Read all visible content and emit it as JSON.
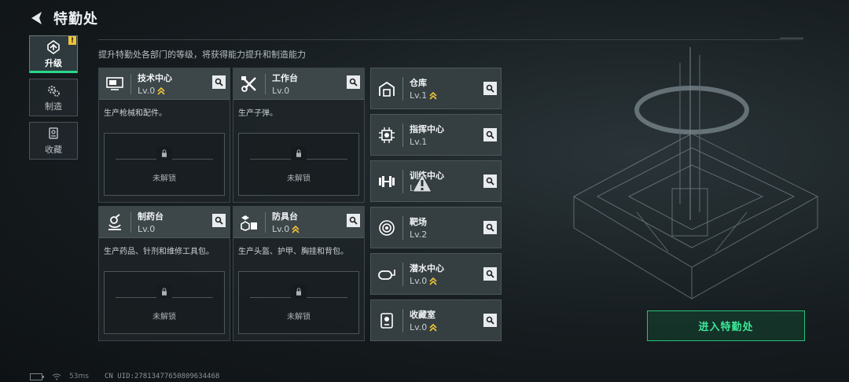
{
  "header": {
    "title": "特勤处",
    "description": "提升特勤处各部门的等级，将获得能力提升和制造能力"
  },
  "nav": {
    "items": [
      {
        "label": "升级",
        "icon": "upgrade-icon",
        "badge": "!"
      },
      {
        "label": "制造",
        "icon": "gear-icon"
      },
      {
        "label": "收藏",
        "icon": "collection-icon"
      }
    ]
  },
  "departments": [
    {
      "name": "技术中心",
      "level": "Lv.0",
      "icon": "computer-icon",
      "upgradeable": true,
      "desc": "生产枪械和配件。",
      "locked": "未解锁"
    },
    {
      "name": "工作台",
      "level": "Lv.0",
      "icon": "tools-icon",
      "upgradeable": false,
      "desc": "生产子弹。",
      "locked": "未解锁"
    },
    {
      "name": "制药台",
      "level": "Lv.0",
      "icon": "microscope-icon",
      "upgradeable": false,
      "desc": "生产药品、针剂和维修工具包。",
      "locked": "未解锁"
    },
    {
      "name": "防具台",
      "level": "Lv.0",
      "icon": "armor-icon",
      "upgradeable": true,
      "desc": "生产头盔、护甲、胸挂和背包。",
      "locked": "未解锁"
    }
  ],
  "facilities": [
    {
      "name": "仓库",
      "level": "Lv.1",
      "icon": "warehouse-icon",
      "upgradeable": true
    },
    {
      "name": "指挥中心",
      "level": "Lv.1",
      "icon": "chip-icon",
      "upgradeable": false
    },
    {
      "name": "训练中心",
      "level": "Lv.0",
      "icon": "dumbbell-icon",
      "upgradeable": false
    },
    {
      "name": "靶场",
      "level": "Lv.2",
      "icon": "target-icon",
      "upgradeable": false
    },
    {
      "name": "潜水中心",
      "level": "Lv.0",
      "icon": "diving-mask-icon",
      "upgradeable": true
    },
    {
      "name": "收藏室",
      "level": "Lv.0",
      "icon": "trophy-icon",
      "upgradeable": true
    }
  ],
  "enter_button": "进入特勤处",
  "footer": {
    "ping": "53ms",
    "uid": "CN UID:278134776508096344​68"
  },
  "colors": {
    "accent_green": "#27d98a",
    "upgrade_gold": "#f0c43a"
  }
}
